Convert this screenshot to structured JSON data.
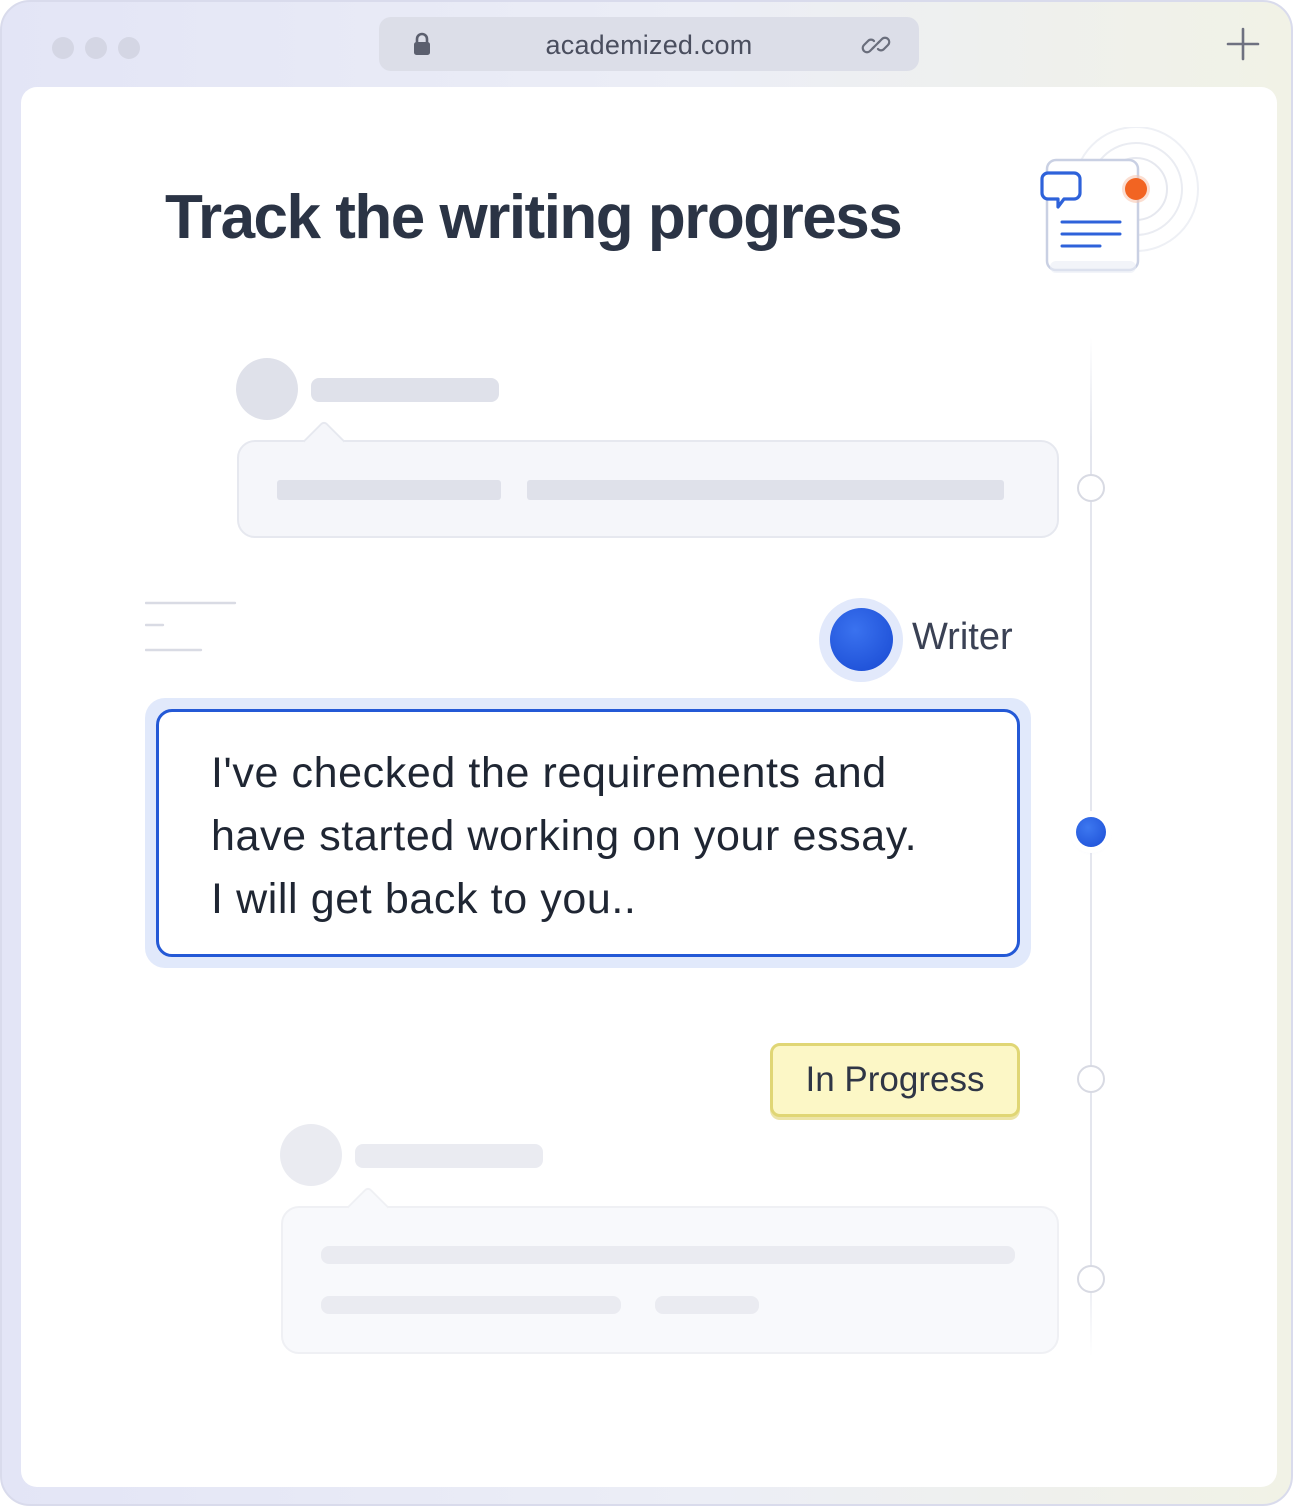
{
  "browser": {
    "url": "academized.com",
    "icons": [
      "lock-icon",
      "link-icon",
      "plus-icon"
    ]
  },
  "page": {
    "title": "Track the writing progress"
  },
  "thread": {
    "writer_label": "Writer",
    "message_lines": [
      "I've checked the requirements and",
      "have started working on your essay.",
      "I will get back to you.."
    ],
    "status": "In Progress"
  },
  "colors": {
    "accent_blue": "#2459d6",
    "notification_orange": "#f26422",
    "status_yellow_bg": "#fcf7c6",
    "title_text": "#2b3445"
  }
}
